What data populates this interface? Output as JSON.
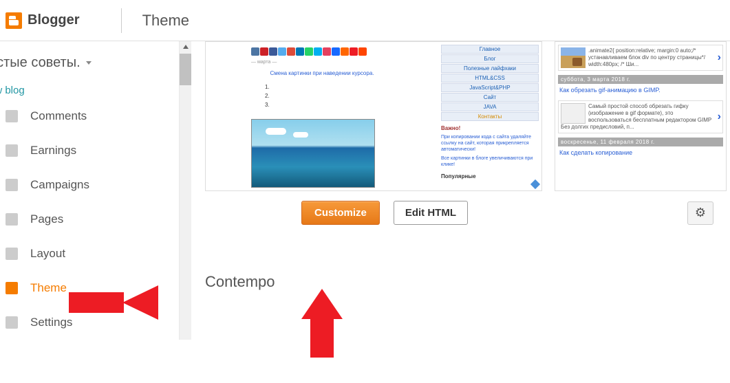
{
  "header": {
    "brand": "Blogger",
    "page_title": "Theme"
  },
  "blog_selector": {
    "name": "остые советы."
  },
  "view_blog": "ew blog",
  "sidebar": {
    "items": [
      {
        "label": "Comments"
      },
      {
        "label": "Earnings"
      },
      {
        "label": "Campaigns"
      },
      {
        "label": "Pages"
      },
      {
        "label": "Layout"
      },
      {
        "label": "Theme"
      },
      {
        "label": "Settings"
      }
    ]
  },
  "preview1": {
    "tiny_caption": "— марта —",
    "link_title": "Смена картинки при наведении курсора.",
    "list": [
      "1.",
      "2.",
      "3."
    ],
    "menu": [
      "Главное",
      "Блог",
      "Полезные лайфхаки",
      "HTML&CSS",
      "JavaScript&PHP",
      "Сайт",
      "JAVA",
      "Контакты"
    ],
    "side_heading": "Важно!",
    "side_text1": "При копировании кода с сайта удаляйте ссылку на сайт, которая прикрепляется автоматически!",
    "side_text2": "Все картинки в блоге увеличиваются при клике!",
    "side_pop": "Популярные",
    "share_colors": [
      "#4c75a3",
      "#cc2127",
      "#3b5998",
      "#55acee",
      "#dd4b39",
      "#0077b5",
      "#25d366",
      "#00aff0",
      "#e4405f",
      "#1769ff",
      "#ff6600",
      "#ee1c25",
      "#ff4500"
    ]
  },
  "preview2": {
    "items": [
      {
        "text": ".animate2{ position:relative; margin:0 auto;/* устанавливаем блок div по центру страницы*/ width:480px; /* Ши..."
      }
    ],
    "date1": "суббота, 3 марта 2018 г.",
    "link1": "Как обрезать gif-анимацию в GIMP.",
    "item2_text": "Самый простой способ обрезать гифку (изображение в gif формате), это воспользоваться бесплатным редактором GIMP Без долгих предисловий, п...",
    "date2": "воскресенье, 11 февраля 2018 г.",
    "link2": "Как сделать копирование"
  },
  "buttons": {
    "customize": "Customize",
    "edit_html": "Edit HTML"
  },
  "section_label": "Contempo"
}
